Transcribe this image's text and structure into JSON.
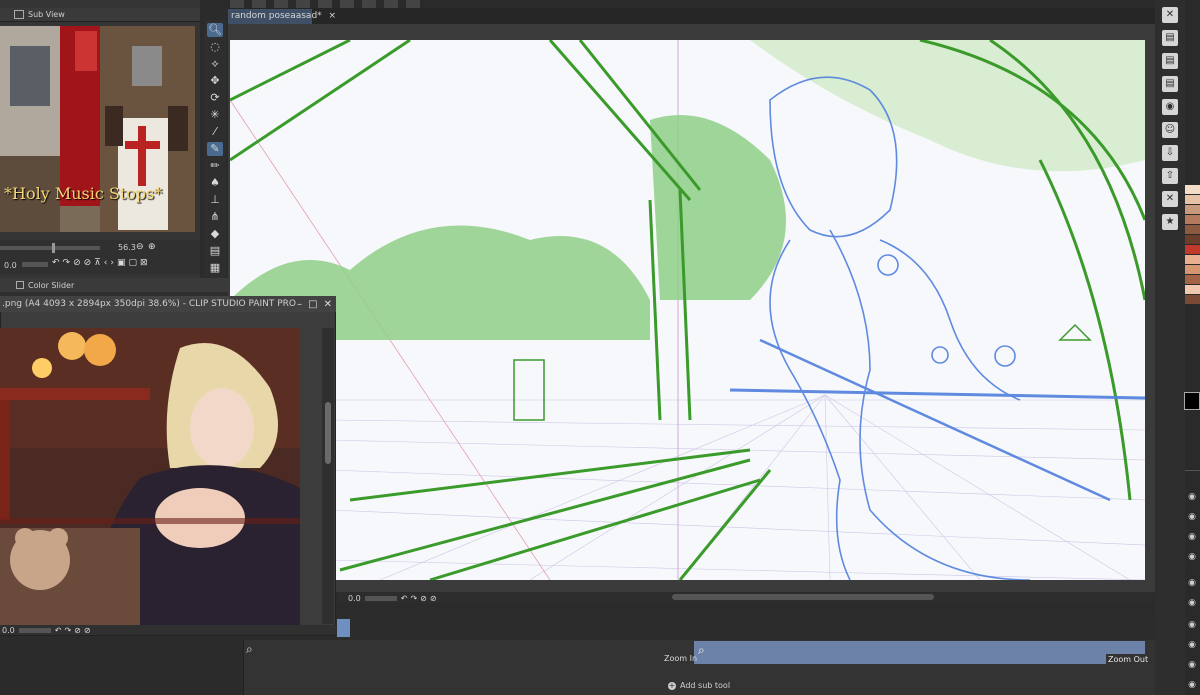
{
  "subview": {
    "title": "Sub View",
    "photo_caption": "*Holy Music Stops*",
    "zoom_value": "56.3",
    "rotation_value": "0.0"
  },
  "color_slider": {
    "title": "Color Slider"
  },
  "canvas": {
    "tab_label": "random poseaasad*",
    "rotation_value": "0.0"
  },
  "float_window": {
    "title": ".png (A4 4093 x 2894px 350dpi 38.6%) - CLIP STUDIO PAINT PRO",
    "rotation_value": "0.0",
    "min_glyph": "–",
    "max_glyph": "□",
    "close_glyph": "✕"
  },
  "timeline": {
    "zoom_in_label": "Zoom In",
    "zoom_out_label": "Zoom Out",
    "add_sub_tool_label": "Add sub tool"
  },
  "palette_colors": [
    "#f3dcc8",
    "#e8c2a6",
    "#c89a7b",
    "#b47a5e",
    "#8e5a3f",
    "#6b3d2b",
    "#c0392b",
    "#e8b090",
    "#d79672",
    "#a36446",
    "#f0c8b0",
    "#7a4a36"
  ],
  "accent_colors": {
    "active_tool": "#4a6a90",
    "tab_active": "#3e4f66",
    "timeline_input": "#6d82a8",
    "perspective_green": "#3a9a2a",
    "sketch_blue": "#4f7fdd"
  }
}
